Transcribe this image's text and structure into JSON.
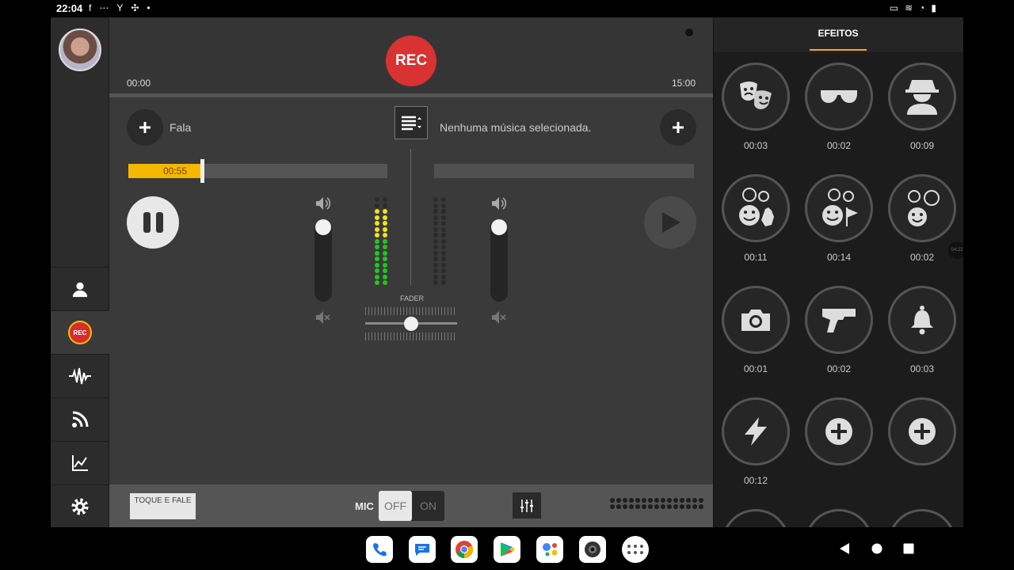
{
  "status": {
    "time": "22:04",
    "icons": [
      "facebook-icon",
      "dash-icon",
      "mail-y-icon",
      "fan-icon",
      "dot-icon"
    ],
    "right_icons": [
      "cast-icon",
      "vibrate-icon",
      "wifi-icon",
      "battery-icon"
    ]
  },
  "sidebar": {
    "items": [
      {
        "name": "profile",
        "icon": "person-icon"
      },
      {
        "name": "rec",
        "label": "REC"
      },
      {
        "name": "audio",
        "icon": "waveform-icon"
      },
      {
        "name": "feed",
        "icon": "rss-icon"
      },
      {
        "name": "stats",
        "icon": "chart-icon"
      },
      {
        "name": "settings",
        "icon": "gear-icon"
      }
    ],
    "active": "rec"
  },
  "recorder": {
    "rec_label": "REC",
    "time_start": "00:00",
    "time_end": "15:00"
  },
  "voice": {
    "label": "Fala",
    "position_label": "00:55",
    "position_fraction": 0.28
  },
  "music": {
    "label": "Nenhuma música selecionada."
  },
  "mixer": {
    "fader_label": "FADER",
    "fader_value": 0.5,
    "left_volume": 1.0,
    "right_volume": 1.0,
    "left_meter": {
      "yellow": 5,
      "green": 8,
      "total": 15
    },
    "right_meter": {
      "yellow": 0,
      "green": 0,
      "total": 15
    }
  },
  "bottom": {
    "ptt_label": "TOQUE E FALE",
    "mic_label": "MIC",
    "toggle_off": "OFF",
    "toggle_on": "ON",
    "toggle_state": "OFF"
  },
  "effects": {
    "tab_label": "EFEITOS",
    "items": [
      {
        "icon": "theater-masks-icon",
        "duration": "00:03"
      },
      {
        "icon": "sunglasses-icon",
        "duration": "00:02"
      },
      {
        "icon": "spy-icon",
        "duration": "00:09"
      },
      {
        "icon": "faces-clap-icon",
        "duration": "00:11"
      },
      {
        "icon": "faces-flag-icon",
        "duration": "00:14"
      },
      {
        "icon": "faces-group-icon",
        "duration": "00:02"
      },
      {
        "icon": "camera-icon",
        "duration": "00:01"
      },
      {
        "icon": "pistol-icon",
        "duration": "00:02"
      },
      {
        "icon": "bell-icon",
        "duration": "00:03"
      },
      {
        "icon": "lightning-icon",
        "duration": "00:12"
      },
      {
        "icon": "add-icon",
        "duration": ""
      },
      {
        "icon": "add-icon",
        "duration": ""
      }
    ],
    "badge": "04:22"
  },
  "navbar": {
    "apps": [
      "phone-icon",
      "messages-icon",
      "chrome-icon",
      "play-store-icon",
      "assistant-icon",
      "camera-app-icon",
      "app-drawer-icon"
    ],
    "nav": [
      "back-icon",
      "home-icon",
      "recents-icon"
    ]
  }
}
